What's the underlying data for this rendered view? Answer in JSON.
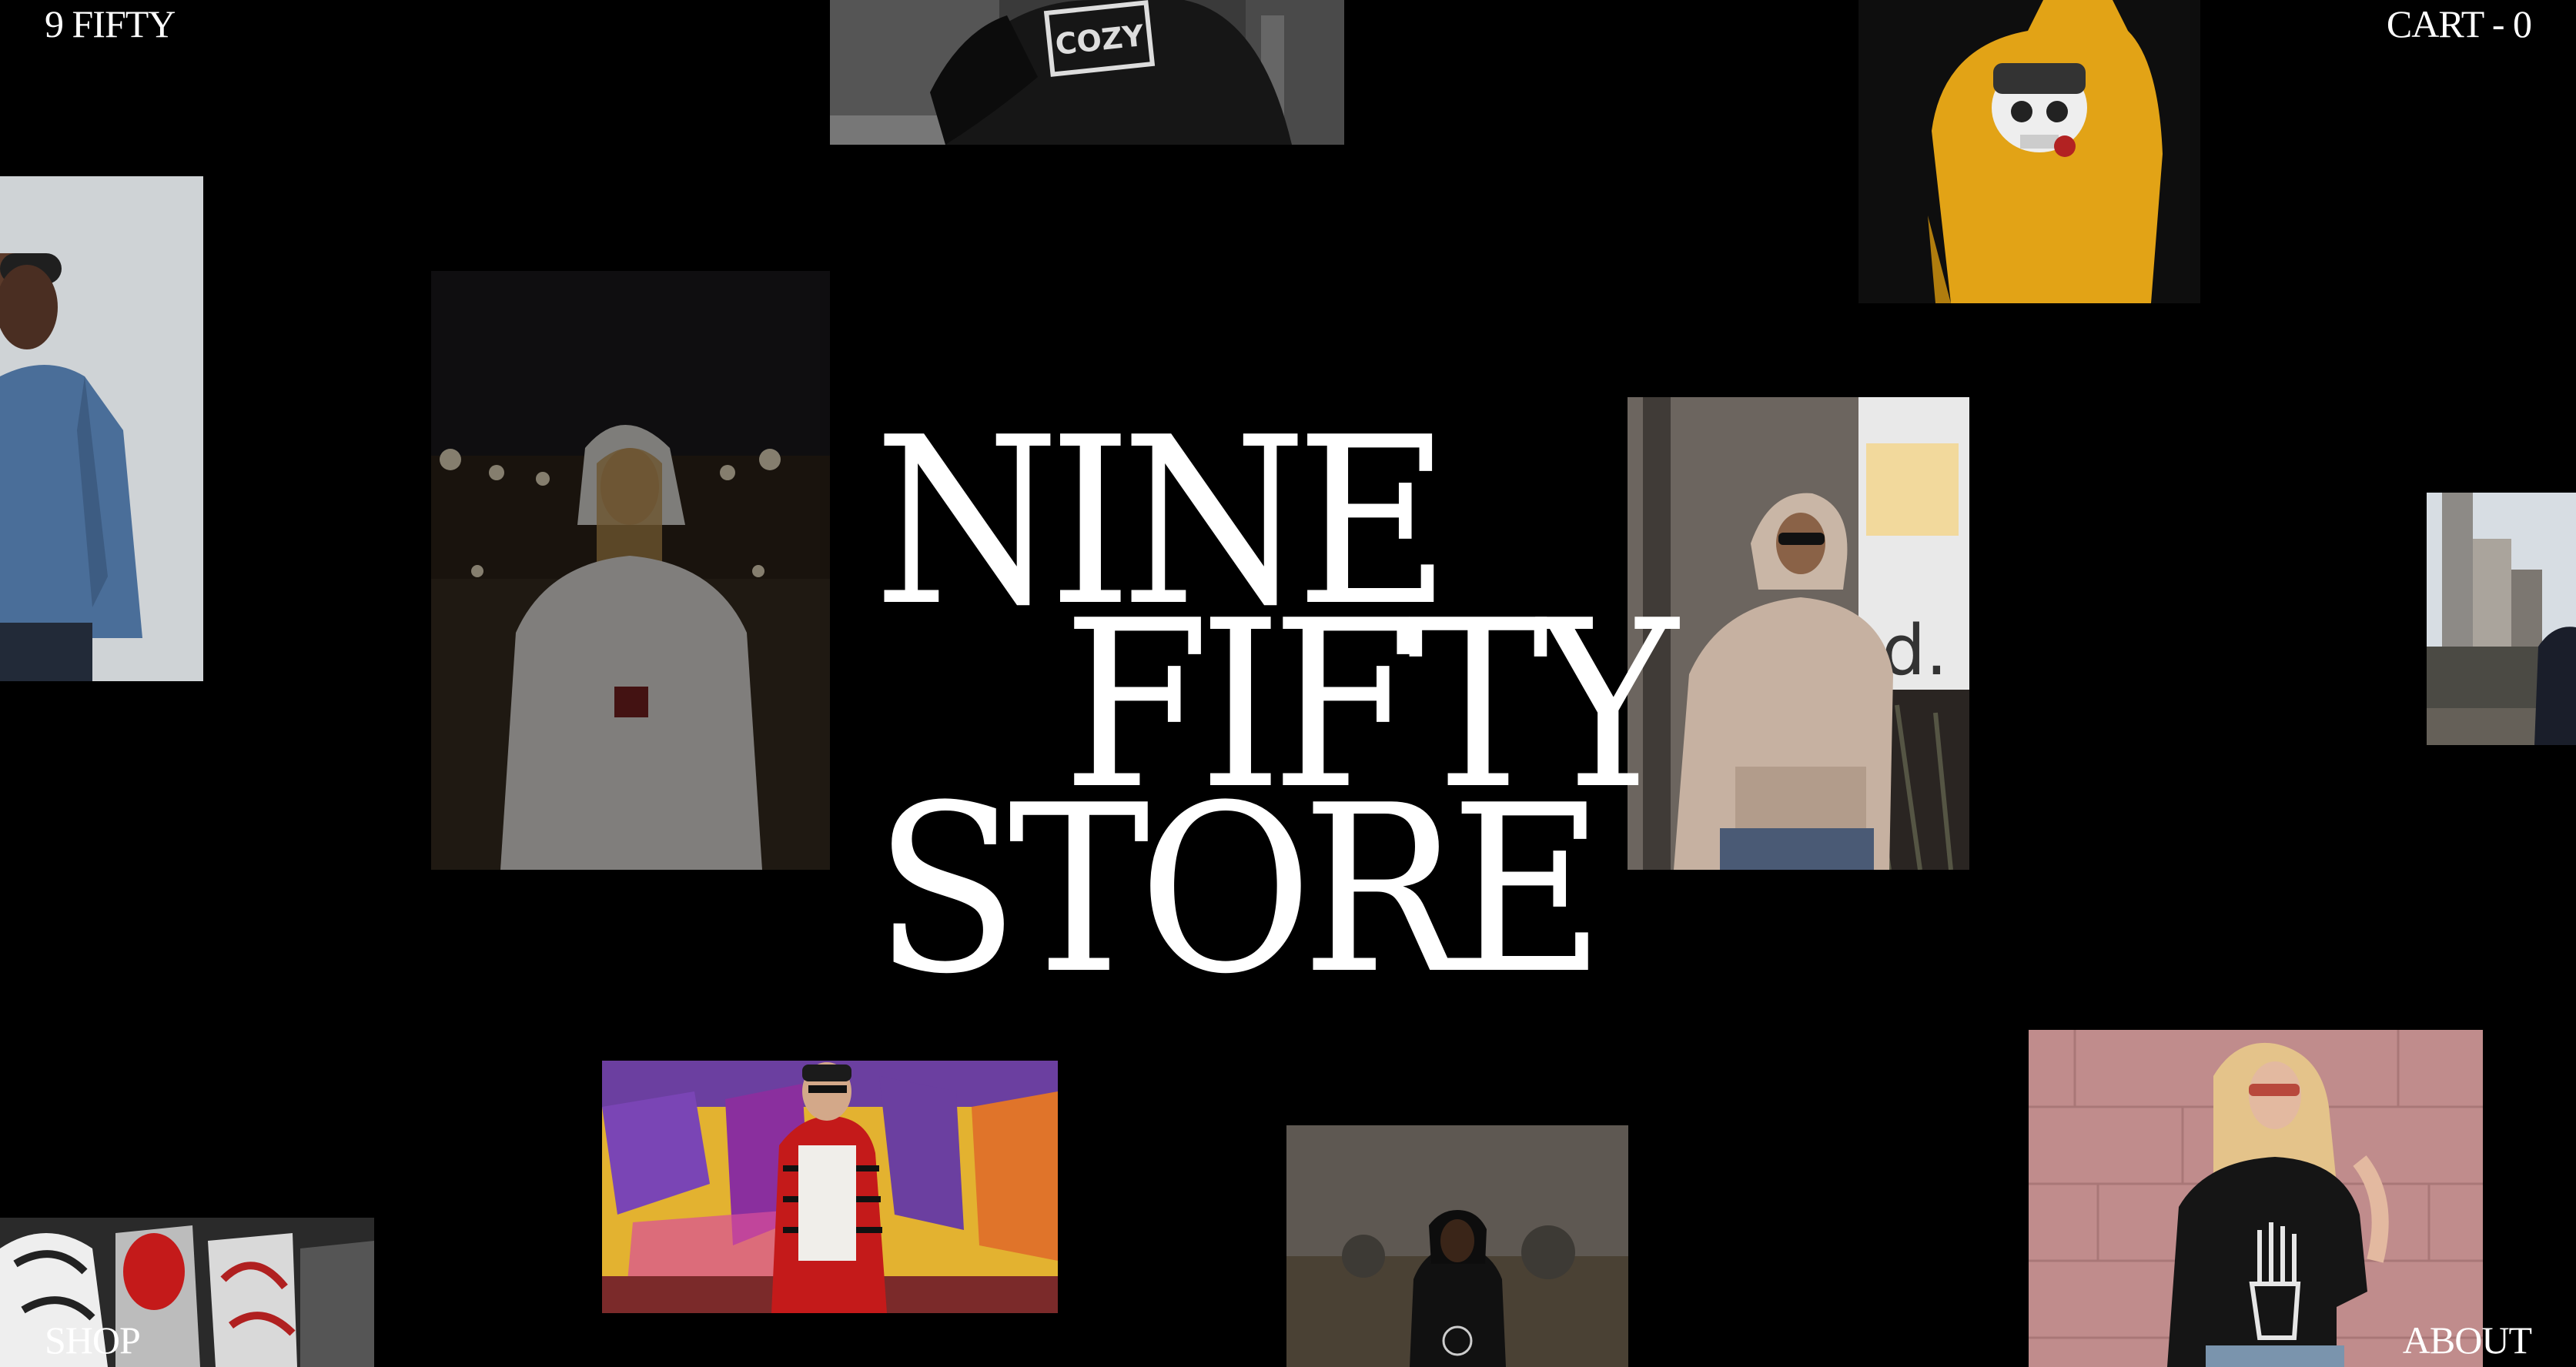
{
  "nav": {
    "logo": "9 FIFTY",
    "cart": "CART - 0",
    "shop": "SHOP",
    "about": "ABOUT"
  },
  "hero": {
    "line1": "NINE",
    "line2": "FIFTY",
    "line3": "STORE"
  },
  "tiles": {
    "cozy_print": "COZY"
  },
  "colors": {
    "background": "#000000",
    "text": "#ffffff",
    "yellow_hoodie": "#e8a714",
    "denim": "#4a6e99",
    "flannel_red": "#c41a1a",
    "pink_wall": "#c98f8f"
  }
}
